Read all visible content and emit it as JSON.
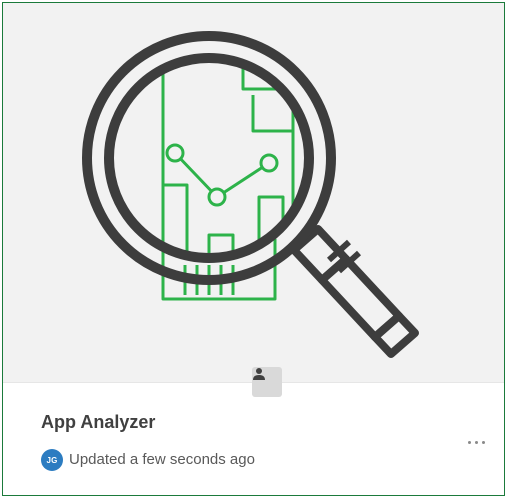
{
  "app": {
    "title": "App Analyzer",
    "updated_text": "Updated a few seconds ago",
    "owner_initials": "JG"
  },
  "icons": {
    "thumbnail": "magnifier-over-app-document-icon",
    "owner": "person-icon",
    "more": "ellipsis-icon"
  },
  "colors": {
    "card_border": "#1b7a3b",
    "thumbnail_green": "#2db34a",
    "magnifier_gray": "#3d3d3d",
    "avatar_blue": "#2c7cc1",
    "thumbnail_bg": "#f2f2f2"
  }
}
